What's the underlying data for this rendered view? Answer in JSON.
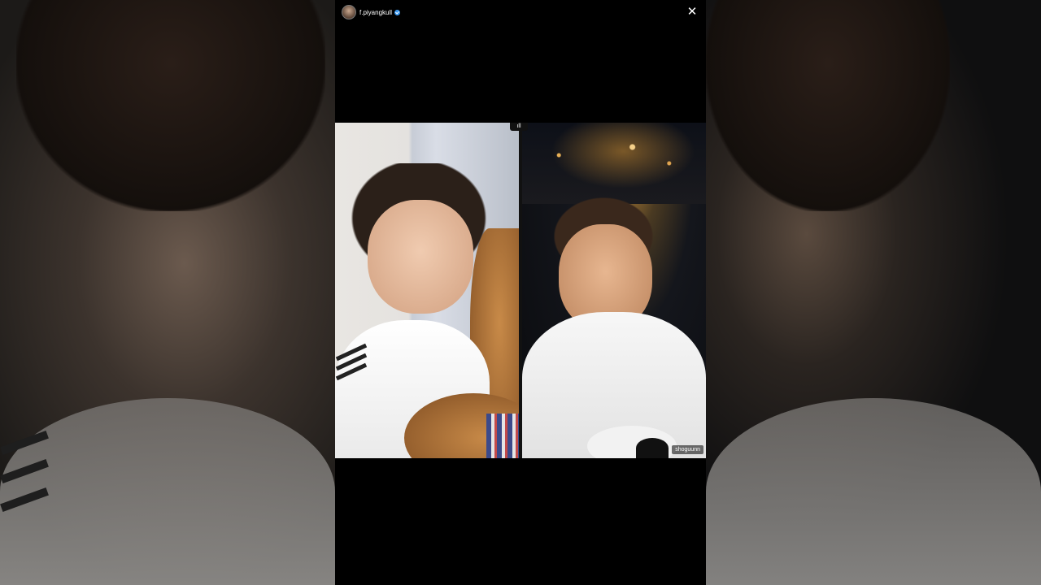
{
  "host": {
    "username": "f.piyangkull",
    "verified": true,
    "avatar_icon": "avatar-icon"
  },
  "controls": {
    "close_icon": "close-icon",
    "close_label": "✕"
  },
  "live_split": {
    "indicator_label": "ıll",
    "guest_username": "shoguunn"
  },
  "colors": {
    "background": "#000000",
    "verified_badge": "#3897f0"
  }
}
